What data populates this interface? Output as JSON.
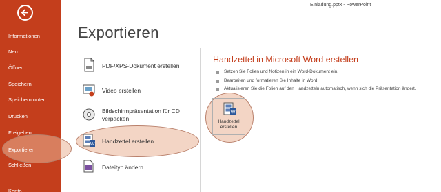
{
  "window": {
    "title": "Einladung.pptx - PowerPoint"
  },
  "sidebar": {
    "items": [
      {
        "label": "Informationen"
      },
      {
        "label": "Neu"
      },
      {
        "label": "Öffnen"
      },
      {
        "label": "Speichern"
      },
      {
        "label": "Speichern unter"
      },
      {
        "label": "Drucken"
      },
      {
        "label": "Freigeben"
      },
      {
        "label": "Exportieren"
      },
      {
        "label": "Schließen"
      },
      {
        "label": "Konto"
      }
    ],
    "active_item": "Exportieren"
  },
  "page": {
    "title": "Exportieren"
  },
  "export_options": [
    {
      "label": "PDF/XPS-Dokument erstellen",
      "icon": "pdf-document-icon"
    },
    {
      "label": "Video erstellen",
      "icon": "video-icon"
    },
    {
      "label_line1": "Bildschirmpräsentation für CD",
      "label_line2": "verpacken",
      "icon": "cd-icon"
    },
    {
      "label": "Handzettel erstellen",
      "icon": "handout-icon",
      "selected": true
    },
    {
      "label": "Dateityp ändern",
      "icon": "file-type-icon"
    }
  ],
  "panel": {
    "title": "Handzettel in Microsoft Word erstellen",
    "bullets": [
      "Setzen Sie Folien und Notizen in ein Word-Dokument ein.",
      "Bearbeiten und formatieren Sie Inhalte in Word.",
      "Aktualisieren Sie die Folien auf den Handzetteln automatisch, wenn sich die Präsentation ändert."
    ],
    "button": {
      "line1": "Handzettel",
      "line2": "erstellen",
      "icon": "handout-icon"
    }
  },
  "colors": {
    "accent": "#c43e1c",
    "sidebar_active": "#a52e10",
    "selected_bg": "#e3e3e3",
    "highlight": "#eab296"
  }
}
